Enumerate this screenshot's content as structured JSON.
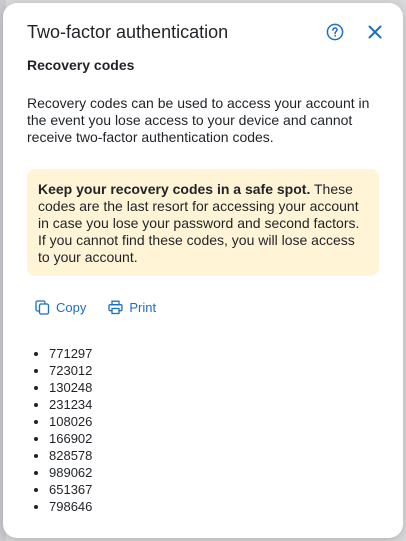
{
  "dialog": {
    "title": "Two-factor authentication",
    "help_icon": "help-circle-icon",
    "close_icon": "close-icon"
  },
  "section": {
    "title": "Recovery codes",
    "intro": "Recovery codes can be used to access your account in the event you lose access to your device and cannot receive two-factor authentication codes."
  },
  "warning": {
    "bold": "Keep your recovery codes in a safe spot.",
    "text": " These codes are the last resort for accessing your account in case you lose your password and second factors. If you cannot find these codes, you will lose access to your account."
  },
  "actions": {
    "copy_label": "Copy",
    "print_label": "Print"
  },
  "codes": [
    "771297",
    "723012",
    "130248",
    "231234",
    "108026",
    "166902",
    "828578",
    "989062",
    "651367",
    "798646"
  ],
  "colors": {
    "accent": "#1a6fc8",
    "warning_bg": "#fff4d6"
  }
}
